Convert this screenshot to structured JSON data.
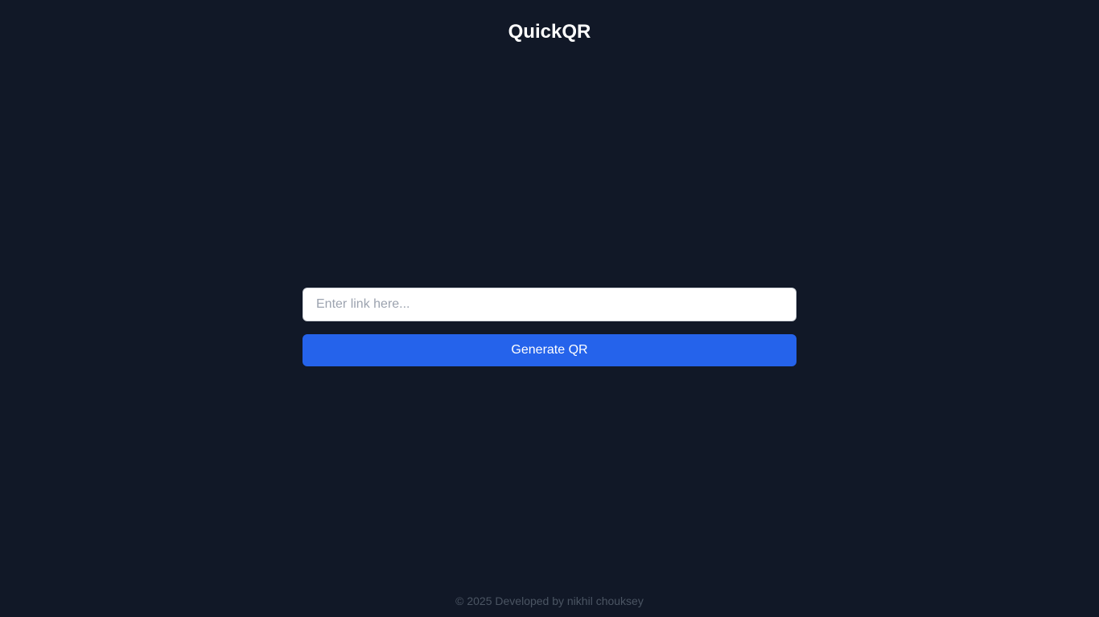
{
  "header": {
    "title": "QuickQR"
  },
  "form": {
    "input_value": "",
    "input_placeholder": "Enter link here...",
    "generate_label": "Generate QR"
  },
  "footer": {
    "text": "© 2025 Developed by nikhil chouksey"
  },
  "colors": {
    "background": "#111827",
    "accent": "#2563eb",
    "footer_text": "#4b5563"
  }
}
